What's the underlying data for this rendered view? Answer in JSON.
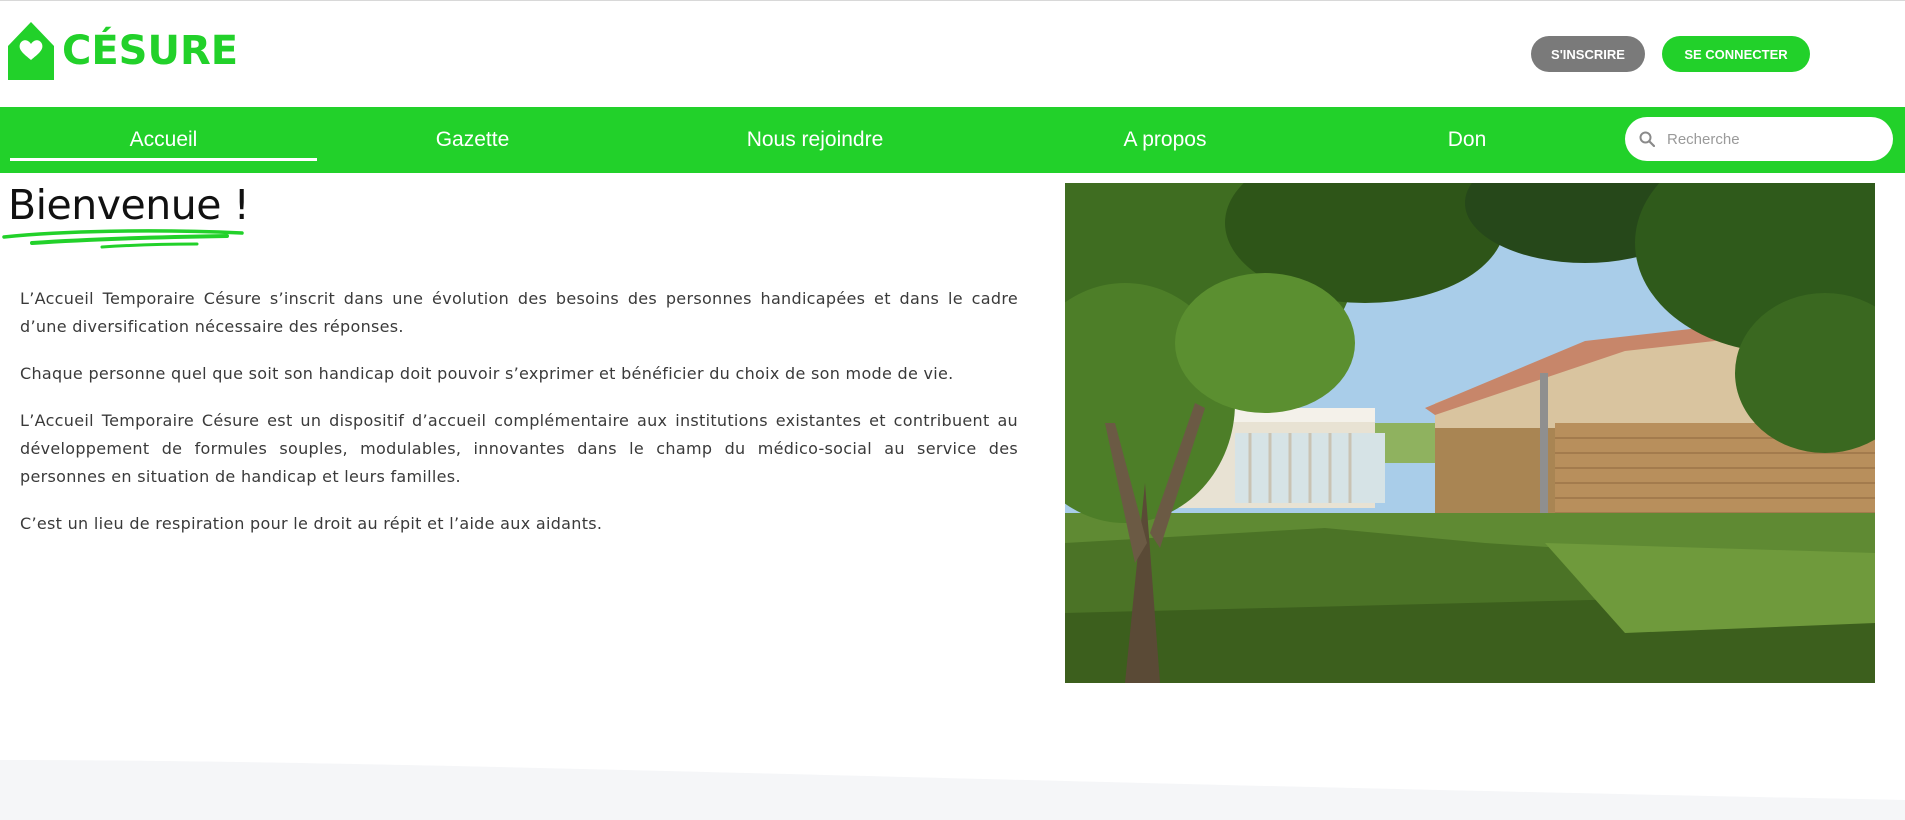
{
  "brand": {
    "name": "CÉSURE",
    "color": "#22d12a"
  },
  "header": {
    "register_label": "S'INSCRIRE",
    "login_label": "SE CONNECTER"
  },
  "nav": {
    "items": [
      {
        "label": "Accueil",
        "active": true
      },
      {
        "label": "Gazette"
      },
      {
        "label": "Nous rejoindre"
      },
      {
        "label": "A propos"
      },
      {
        "label": "Don"
      }
    ],
    "search_placeholder": "Recherche",
    "search_icon": "search-icon"
  },
  "main": {
    "title": "Bienvenue !",
    "paragraphs": [
      "L’Accueil Temporaire Césure s’inscrit dans une évolution des besoins des personnes handicapées et dans le cadre d’une diversification nécessaire des réponses.",
      "Chaque personne quel que soit son handicap doit pouvoir s’exprimer et bénéficier du choix de son mode de vie.",
      "L’Accueil Temporaire Césure est un dispositif d’accueil complémentaire aux institutions existantes et contribuent au développement de formules souples, modulables, innovantes dans le champ du médico-social au service des personnes en situation de handicap et leurs familles.",
      "C’est un lieu de respiration pour le droit au répit et l’aide aux aidants."
    ]
  },
  "colors": {
    "accent": "#22d12a",
    "register_button": "#7a7a7a"
  }
}
